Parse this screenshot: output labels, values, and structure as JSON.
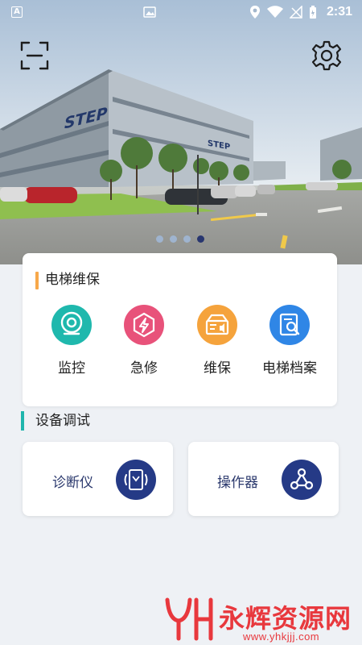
{
  "status_bar": {
    "time": "2:31",
    "left_badge": "A"
  },
  "banner": {
    "building_sign_main": "STEP",
    "building_sign_side": "STEP",
    "slides": 4,
    "active_slide": 4
  },
  "elevator_section": {
    "title": "电梯维保",
    "items": [
      {
        "label": "监控",
        "icon": "camera-icon",
        "color": "#1fb8ad"
      },
      {
        "label": "急修",
        "icon": "lightning-icon",
        "color": "#e8527a"
      },
      {
        "label": "维保",
        "icon": "maintenance-box-icon",
        "color": "#f5a33c"
      },
      {
        "label": "电梯档案",
        "icon": "archive-search-icon",
        "color": "#2f86e6"
      }
    ]
  },
  "device_section": {
    "title": "设备调试",
    "tools": [
      {
        "label": "诊断仪",
        "icon": "diagnostic-icon"
      },
      {
        "label": "操作器",
        "icon": "network-icon"
      }
    ]
  },
  "watermark": {
    "logo_text": "YH",
    "text": "永辉资源网",
    "url": "www.yhkjjj.com"
  },
  "colors": {
    "accent_orange": "#f7a84a",
    "accent_teal": "#1fb5ad",
    "tool_blue": "#253a86",
    "dot_active": "#28366f",
    "watermark_red": "#e8383d"
  }
}
